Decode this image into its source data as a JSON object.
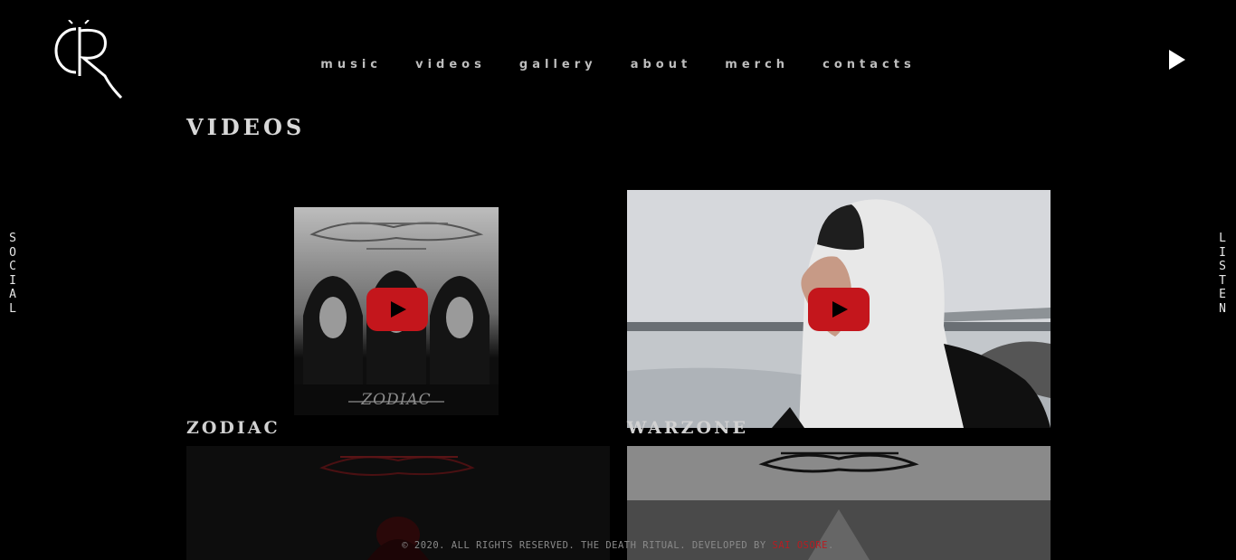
{
  "nav": {
    "items": [
      {
        "label": "music"
      },
      {
        "label": "videos"
      },
      {
        "label": "gallery"
      },
      {
        "label": "about"
      },
      {
        "label": "merch"
      },
      {
        "label": "contacts"
      }
    ]
  },
  "page": {
    "title": "VIDEOS"
  },
  "side": {
    "social_letters": [
      "S",
      "O",
      "C",
      "I",
      "A",
      "L"
    ],
    "listen_letters": [
      "L",
      "I",
      "S",
      "T",
      "E",
      "N"
    ]
  },
  "videos": [
    {
      "title": "ZODIAC",
      "thumb_caption": "ZODIAC"
    },
    {
      "title": "WARZONE"
    }
  ],
  "footer": {
    "text": "© 2020. ALL RIGHTS RESERVED. THE DEATH RITUAL. DEVELOPED BY ",
    "link": "SAI OSORE",
    "suffix": "."
  },
  "colors": {
    "accent": "#c4161c",
    "background": "#000000"
  }
}
